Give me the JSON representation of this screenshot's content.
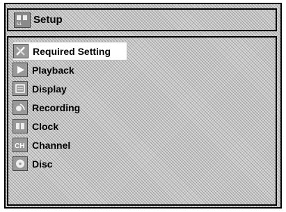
{
  "header": {
    "icon": "setup-icon",
    "title": "Setup"
  },
  "menu": {
    "selected_index": 0,
    "items": [
      {
        "label": "Required Setting",
        "icon": "wrench-screwdriver-icon"
      },
      {
        "label": "Playback",
        "icon": "play-icon"
      },
      {
        "label": "Display",
        "icon": "display-icon"
      },
      {
        "label": "Recording",
        "icon": "record-icon"
      },
      {
        "label": "Clock",
        "icon": "clock-icon"
      },
      {
        "label": "Channel",
        "icon": "channel-icon"
      },
      {
        "label": "Disc",
        "icon": "disc-icon"
      }
    ]
  }
}
